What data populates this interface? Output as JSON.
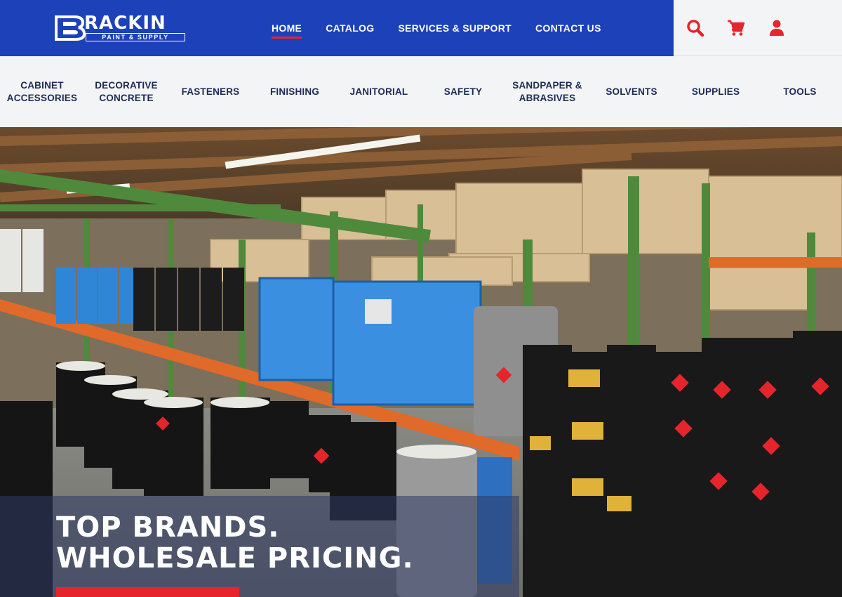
{
  "brand": {
    "name": "RACKIN",
    "tagline": "PAINT & SUPPLY",
    "primary_color": "#1c41b8",
    "accent_color": "#e5242c"
  },
  "nav": {
    "items": [
      {
        "label": "HOME",
        "active": true
      },
      {
        "label": "CATALOG",
        "active": false
      },
      {
        "label": "SERVICES & SUPPORT",
        "active": false
      },
      {
        "label": "CONTACT US",
        "active": false
      }
    ]
  },
  "actions": {
    "icons": [
      "search-icon",
      "cart-icon",
      "account-icon"
    ],
    "color": "#e5242c"
  },
  "categories": [
    {
      "line1": "CABINET",
      "line2": "ACCESSORIES"
    },
    {
      "line1": "DECORATIVE",
      "line2": "CONCRETE"
    },
    {
      "line1": "FASTENERS",
      "line2": ""
    },
    {
      "line1": "FINISHING",
      "line2": ""
    },
    {
      "line1": "JANITORIAL",
      "line2": ""
    },
    {
      "line1": "SAFETY",
      "line2": ""
    },
    {
      "line1": "SANDPAPER &",
      "line2": "ABRASIVES"
    },
    {
      "line1": "SOLVENTS",
      "line2": ""
    },
    {
      "line1": "SUPPLIES",
      "line2": ""
    },
    {
      "line1": "TOOLS",
      "line2": ""
    }
  ],
  "hero": {
    "line1": "TOP BRANDS.",
    "line2": "WHOLESALE PRICING.",
    "image": "warehouse-drums-and-pails-photo"
  }
}
